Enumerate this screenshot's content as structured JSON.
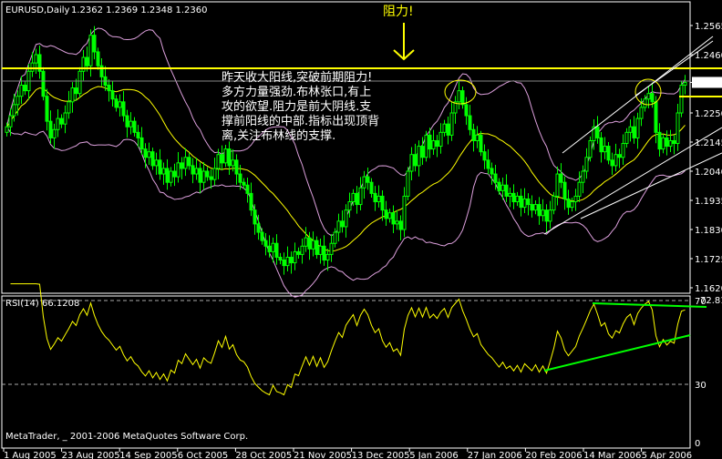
{
  "header": {
    "symbol_title": "EURUSD,Daily",
    "ohlc": "1.2362 1.2369 1.2348 1.2360"
  },
  "annotations": {
    "resistance_label": "阻力!",
    "note_lines": [
      "昨天收大阳线,突破前期阻力!",
      "多方力量强劲.布林张口,有上",
      "攻的欲望.阻力是前大阴线.支",
      "撑前阳线的中部.指标出现顶背",
      "离,关注布林线的支撑."
    ]
  },
  "rsi_pane": {
    "label": "RSI(14) 66.1208",
    "current_value": "72.8104",
    "levels": [
      "70",
      "30",
      "0"
    ]
  },
  "footer": {
    "copyright": "MetaTrader, _ 2001-2006 MetaQuotes Software Corp."
  },
  "colors": {
    "background": "#000000",
    "candle": "#00ff00",
    "bollinger": "#dda0dd",
    "ma": "#ffff00",
    "rsi": "#ffff00",
    "resistance_line": "#ffff00",
    "trendline": "#ffffff",
    "rsi_trendline": "#00ff00"
  },
  "chart_data": {
    "type": "candlestick",
    "price_axis_ticks": [
      "1.2565",
      "1.2460",
      "1.2360",
      "1.2250",
      "1.2145",
      "1.2040",
      "1.1935",
      "1.1830",
      "1.1725",
      "1.1620"
    ],
    "current_price": "1.2360",
    "ylim": [
      1.162,
      1.2565
    ],
    "date_ticks": [
      "1 Aug 2005",
      "23 Aug 2005",
      "14 Sep 2005",
      "6 Oct 2005",
      "28 Oct 2005",
      "21 Nov 2005",
      "13 Dec 2005",
      "5 Jan 2006",
      "27 Jan 2006",
      "20 Feb 2006",
      "14 Mar 2006",
      "5 Apr 2006"
    ],
    "resistance_level": 1.24,
    "support_marker": 1.231,
    "closes": [
      1.22,
      1.224,
      1.228,
      1.231,
      1.235,
      1.233,
      1.24,
      1.243,
      1.246,
      1.24,
      1.231,
      1.222,
      1.216,
      1.219,
      1.223,
      1.221,
      1.225,
      1.229,
      1.234,
      1.232,
      1.24,
      1.245,
      1.242,
      1.253,
      1.247,
      1.242,
      1.238,
      1.235,
      1.233,
      1.23,
      1.227,
      1.229,
      1.224,
      1.22,
      1.222,
      1.218,
      1.216,
      1.212,
      1.209,
      1.211,
      1.206,
      1.208,
      1.203,
      1.205,
      1.2,
      1.204,
      1.202,
      1.207,
      1.205,
      1.209,
      1.206,
      1.203,
      1.205,
      1.2,
      1.204,
      1.202,
      1.201,
      1.205,
      1.21,
      1.207,
      1.212,
      1.206,
      1.208,
      1.203,
      1.2,
      1.199,
      1.196,
      1.19,
      1.185,
      1.182,
      1.179,
      1.177,
      1.175,
      1.178,
      1.173,
      1.172,
      1.17,
      1.173,
      1.171,
      1.175,
      1.174,
      1.177,
      1.18,
      1.176,
      1.179,
      1.174,
      1.177,
      1.172,
      1.174,
      1.178,
      1.182,
      1.186,
      1.184,
      1.19,
      1.193,
      1.196,
      1.192,
      1.198,
      1.202,
      1.2,
      1.196,
      1.193,
      1.195,
      1.19,
      1.187,
      1.189,
      1.185,
      1.186,
      1.183,
      1.195,
      1.204,
      1.21,
      1.206,
      1.213,
      1.209,
      1.217,
      1.212,
      1.215,
      1.213,
      1.218,
      1.221,
      1.217,
      1.225,
      1.229,
      1.233,
      1.228,
      1.224,
      1.219,
      1.215,
      1.217,
      1.211,
      1.208,
      1.205,
      1.203,
      1.2,
      1.197,
      1.199,
      1.195,
      1.196,
      1.193,
      1.195,
      1.191,
      1.194,
      1.192,
      1.19,
      1.192,
      1.188,
      1.19,
      1.186,
      1.19,
      1.195,
      1.203,
      1.2,
      1.194,
      1.191,
      1.193,
      1.195,
      1.2,
      1.204,
      1.209,
      1.215,
      1.22,
      1.216,
      1.211,
      1.213,
      1.208,
      1.206,
      1.21,
      1.209,
      1.214,
      1.218,
      1.22,
      1.216,
      1.223,
      1.227,
      1.23,
      1.232,
      1.229,
      1.218,
      1.212,
      1.216,
      1.213,
      1.215,
      1.214,
      1.225,
      1.235,
      1.236
    ],
    "indicators": [
      "Bollinger Bands",
      "Moving Average",
      "RSI(14)"
    ]
  }
}
